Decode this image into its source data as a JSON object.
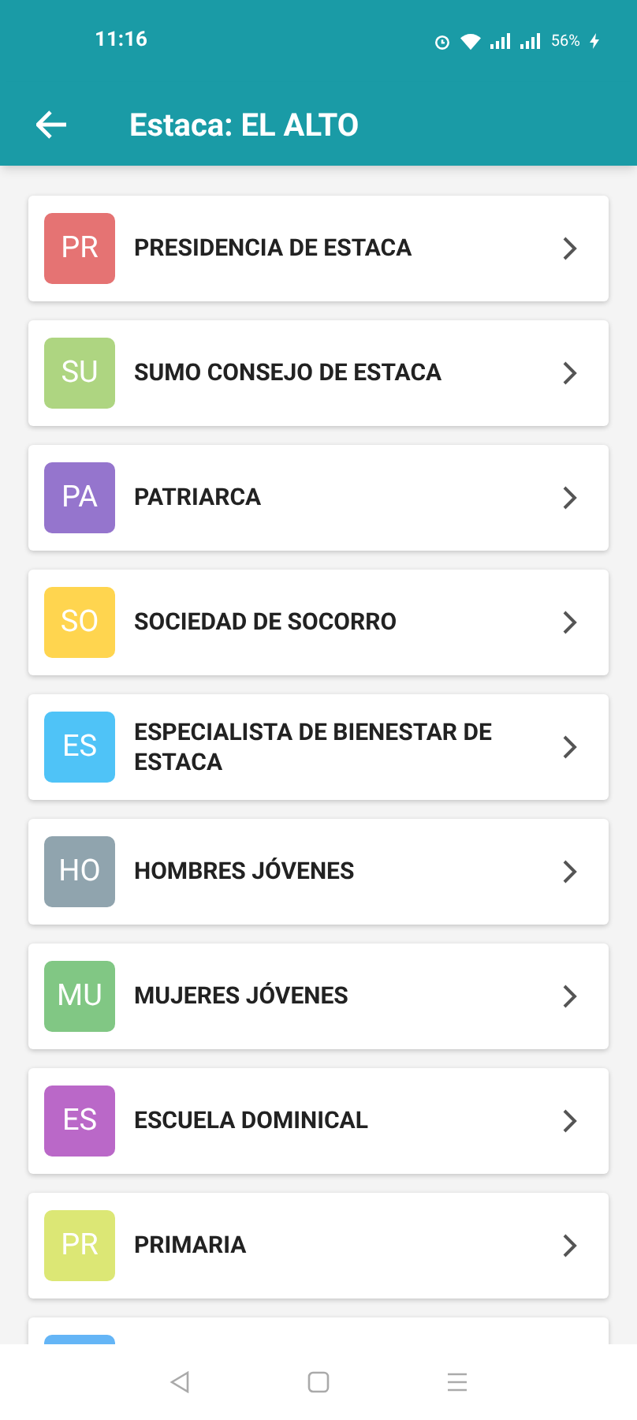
{
  "status_bar": {
    "time": "11:16",
    "battery": "56%"
  },
  "app_bar": {
    "title": "Estaca: EL ALTO"
  },
  "items": [
    {
      "kind": "full",
      "initials": "PR",
      "label": "PRESIDENCIA DE ESTACA",
      "color": "#e57373"
    },
    {
      "kind": "full",
      "initials": "SU",
      "label": "SUMO CONSEJO DE ESTACA",
      "color": "#aed581"
    },
    {
      "kind": "full",
      "initials": "PA",
      "label": "PATRIARCA",
      "color": "#9575cd"
    },
    {
      "kind": "full",
      "initials": "SO",
      "label": "SOCIEDAD DE SOCORRO",
      "color": "#ffd54f"
    },
    {
      "kind": "full",
      "initials": "ES",
      "label": "ESPECIALISTA DE BIENESTAR DE ESTACA",
      "color": "#4fc3f7"
    },
    {
      "kind": "full",
      "initials": "HO",
      "label": "HOMBRES JÓVENES",
      "color": "#90a4ae"
    },
    {
      "kind": "full",
      "initials": "MU",
      "label": "MUJERES JÓVENES",
      "color": "#81c784"
    },
    {
      "kind": "full",
      "initials": "ES",
      "label": "ESCUELA DOMINICAL",
      "color": "#ba68c8"
    },
    {
      "kind": "full",
      "initials": "PR",
      "label": "PRIMARIA",
      "color": "#dce775"
    },
    {
      "kind": "partial",
      "color": "#64b5f6"
    }
  ]
}
